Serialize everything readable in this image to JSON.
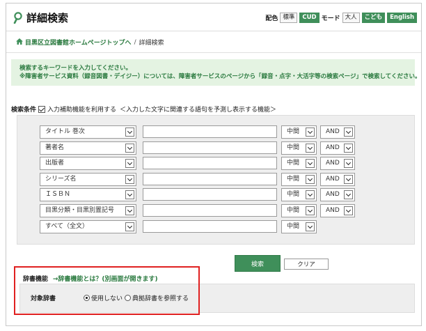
{
  "header": {
    "title": "詳細検索",
    "color_label": "配色",
    "btn_standard": "標準",
    "btn_cud": "CUD",
    "mode_label": "モード",
    "btn_adult": "大人",
    "btn_kids": "こども",
    "btn_english": "English"
  },
  "breadcrumb": {
    "home": "目黒区立図書館ホームページトップへ",
    "separator": "/",
    "current": "詳細検索"
  },
  "info": {
    "line1": "検索するキーワードを入力してください。",
    "line2": "※障害者サービス資料（録音図書・デイジー）については、障害者サービスのページから「録音・点字・大活字等の検索ページ」で検索してください。"
  },
  "conditions": {
    "heading": "検索条件",
    "assist_label": "入力補助機能を利用する",
    "assist_note": "＜入力した文字に関連する語句を予測し表示する機能＞",
    "rows": [
      {
        "field": "タイトル 巻次",
        "value": "",
        "match": "中間",
        "op": "AND"
      },
      {
        "field": "著者名",
        "value": "",
        "match": "中間",
        "op": "AND"
      },
      {
        "field": "出版者",
        "value": "",
        "match": "中間",
        "op": "AND"
      },
      {
        "field": "シリーズ名",
        "value": "",
        "match": "中間",
        "op": "AND"
      },
      {
        "field": "ＩＳＢＮ",
        "value": "",
        "match": "中間",
        "op": "AND"
      },
      {
        "field": "目黒分類・目黒別置記号",
        "value": "",
        "match": "中間",
        "op": "AND"
      },
      {
        "field": "すべて（全文）",
        "value": "",
        "match": "中間",
        "op": ""
      }
    ]
  },
  "actions": {
    "search": "検索",
    "clear": "クリア"
  },
  "dictionary": {
    "heading": "辞書機能",
    "link": "→辞書機能とは？(別画面が開きます)",
    "target_label": "対象辞書",
    "option_none": "使用しない",
    "option_ref": "典拠辞書を参照する"
  },
  "colors": {
    "accent_green": "#3f8f5a",
    "link_green": "#2a7a3f",
    "info_bg": "#e4f3e2",
    "highlight_red": "#e02020"
  }
}
